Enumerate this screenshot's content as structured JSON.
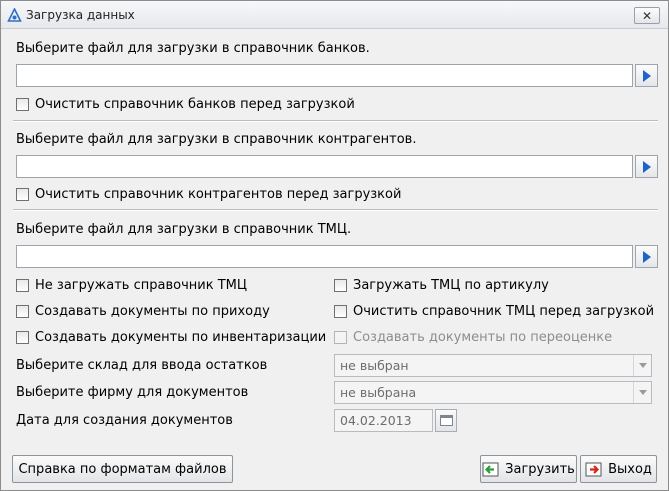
{
  "window": {
    "title": "Загрузка данных",
    "close_glyph": "✕"
  },
  "banks": {
    "label": "Выберите файл для загрузки в справочник банков.",
    "file_value": "",
    "clear_label": "Очистить справочник банков перед загрузкой",
    "clear_checked": false
  },
  "contractors": {
    "label": "Выберите файл для загрузки в справочник контрагентов.",
    "file_value": "",
    "clear_label": "Очистить справочник контрагентов перед загрузкой",
    "clear_checked": false
  },
  "goods": {
    "label": "Выберите файл для загрузки в справочник ТМЦ.",
    "file_value": "",
    "options": {
      "no_load_label": "Не загружать справочник ТМЦ",
      "by_article_label": "Загружать ТМЦ по артикулу",
      "create_incoming_label": "Создавать документы по приходу",
      "clear_goods_label": "Очистить справочник ТМЦ перед загрузкой",
      "create_inventory_label": "Создавать документы по инвентаризации",
      "create_revaluation_label": "Создавать документы по переоценке"
    }
  },
  "settings": {
    "warehouse_label": "Выберите склад для ввода остатков",
    "warehouse_value": "не выбран",
    "firm_label": "Выберите фирму для документов",
    "firm_value": "не выбрана",
    "date_label": "Дата для создания документов",
    "date_value": "04.02.2013"
  },
  "footer": {
    "help_label": "Справка по форматам файлов",
    "load_label": "Загрузить",
    "exit_label": "Выход"
  },
  "icons": {
    "title": "app-icon",
    "browse": "play-arrow-icon",
    "calendar": "calendar-icon",
    "load": "import-icon",
    "exit": "exit-icon"
  },
  "colors": {
    "accent_blue": "#1d63c9",
    "exit_red": "#d9261c",
    "load_green": "#2f9a3a"
  }
}
